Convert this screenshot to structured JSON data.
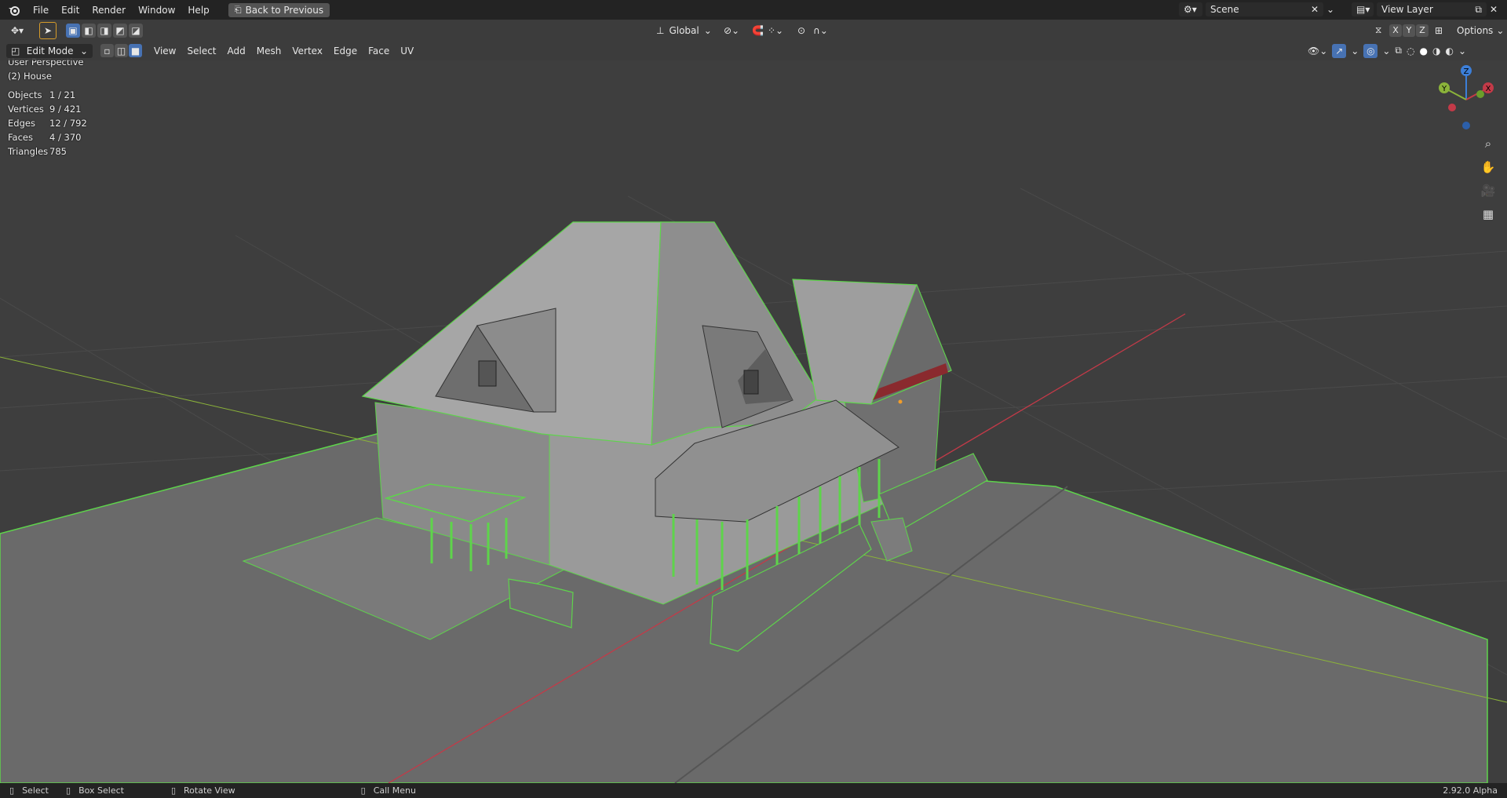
{
  "topbar": {
    "menu": [
      "File",
      "Edit",
      "Render",
      "Window",
      "Help"
    ],
    "back_button": "Back to Previous",
    "scene_label": "Scene",
    "view_layer_label": "View Layer"
  },
  "toolbar": {
    "transform_orientation": "Global",
    "options_label": "Options",
    "axis_labels": [
      "X",
      "Y",
      "Z"
    ]
  },
  "header": {
    "mode": "Edit Mode",
    "menus": [
      "View",
      "Select",
      "Add",
      "Mesh",
      "Vertex",
      "Edge",
      "Face",
      "UV"
    ]
  },
  "viewport": {
    "perspective": "User Perspective",
    "object_name": "(2) House",
    "stats": [
      {
        "label": "Objects",
        "value": "1 / 21"
      },
      {
        "label": "Vertices",
        "value": "9 / 421"
      },
      {
        "label": "Edges",
        "value": "12 / 792"
      },
      {
        "label": "Faces",
        "value": "4 / 370"
      },
      {
        "label": "Triangles",
        "value": "785"
      }
    ],
    "gizmo_axes": {
      "x": "X",
      "y": "Y",
      "z": "Z"
    }
  },
  "statusbar": {
    "items": [
      "Select",
      "Box Select",
      "Rotate View",
      "Call Menu"
    ],
    "version": "2.92.0 Alpha"
  },
  "colors": {
    "selection_outline": "#5ed44b",
    "x_axis": "#c33a48",
    "y_axis": "#8bb33a",
    "z_axis": "#3c7fd9",
    "active_button": "#4772b3"
  },
  "icons": [
    "blender-logo-icon",
    "back-icon",
    "scene-icon",
    "view-layer-icon",
    "cursor-icon",
    "select-box-icon",
    "vertex-mode-icon",
    "edge-mode-icon",
    "face-mode-icon",
    "zoom-icon",
    "hand-icon",
    "camera-icon",
    "grid-icon",
    "mouse-icon"
  ]
}
